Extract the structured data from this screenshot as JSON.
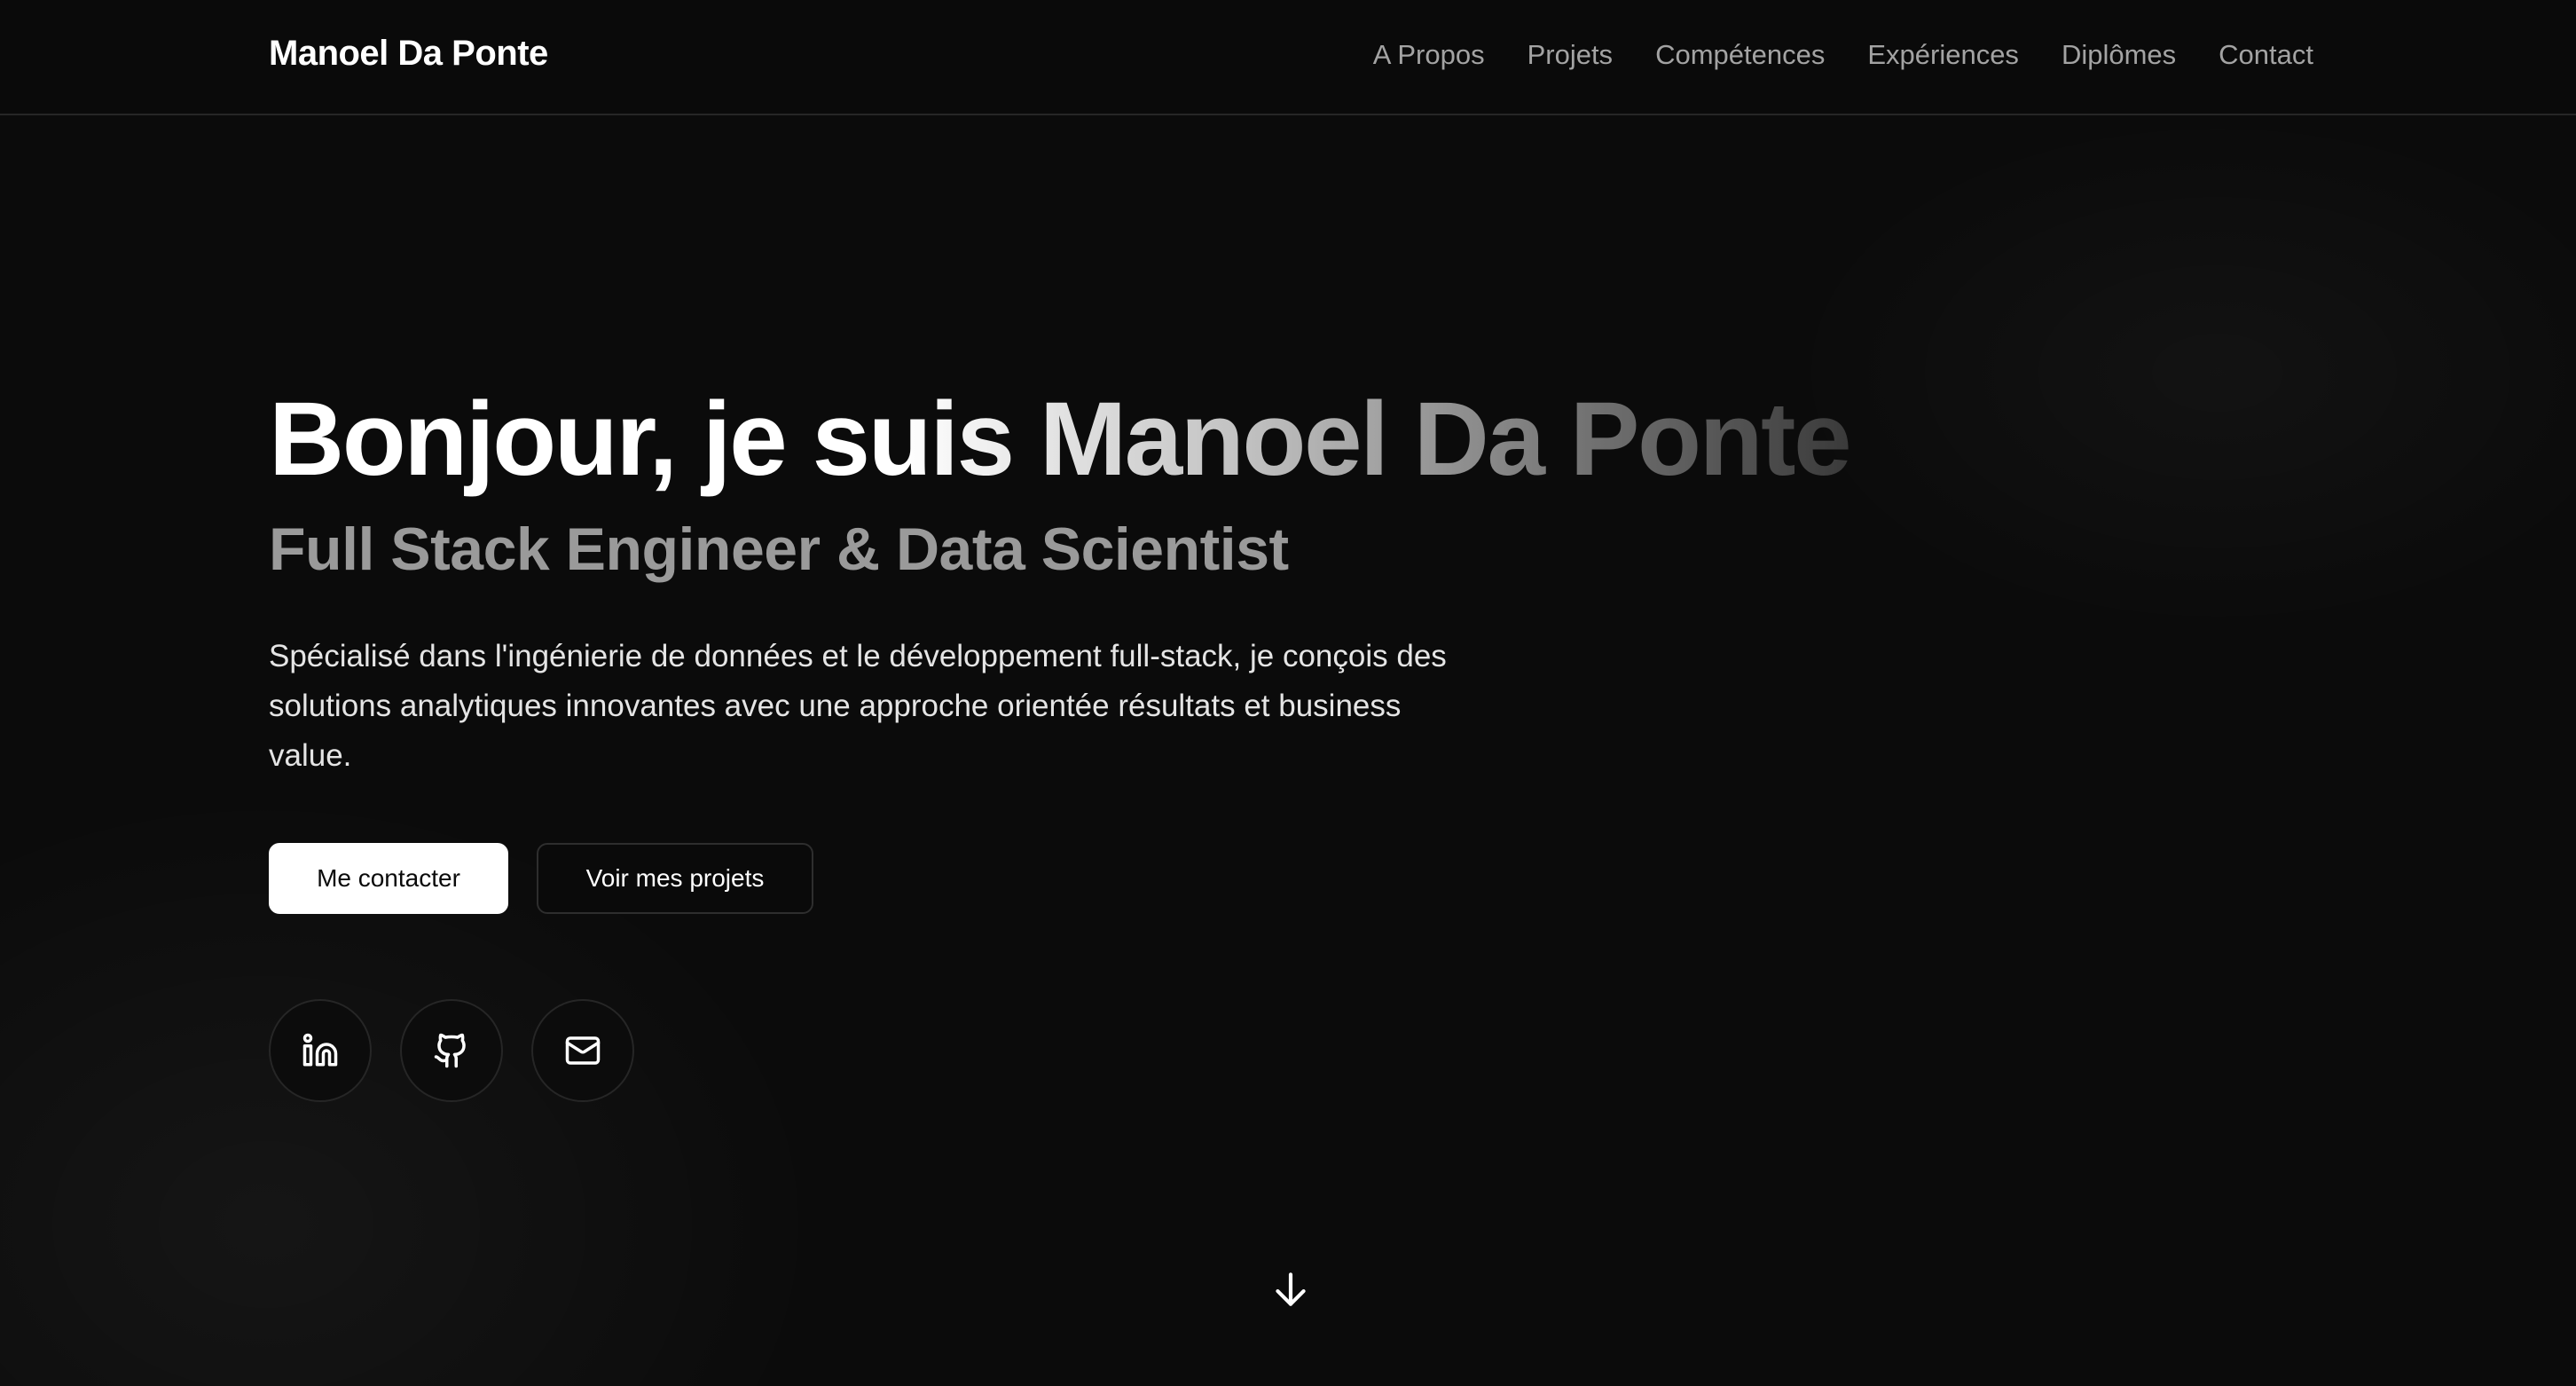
{
  "header": {
    "brand": "Manoel Da Ponte",
    "nav": [
      {
        "label": "A Propos"
      },
      {
        "label": "Projets"
      },
      {
        "label": "Compétences"
      },
      {
        "label": "Expériences"
      },
      {
        "label": "Diplômes"
      },
      {
        "label": "Contact"
      }
    ]
  },
  "hero": {
    "title": "Bonjour, je suis Manoel Da Ponte",
    "subtitle": "Full Stack Engineer & Data Scientist",
    "description": "Spécialisé dans l'ingénierie de données et le développement full-stack, je conçois des solutions analytiques innovantes avec une approche orientée résultats et business value.",
    "primary_button": "Me contacter",
    "secondary_button": "Voir mes projets",
    "socials": [
      {
        "icon": "linkedin-icon"
      },
      {
        "icon": "github-icon"
      },
      {
        "icon": "mail-icon"
      }
    ],
    "scroll_icon": "arrow-down-icon"
  },
  "colors": {
    "background": "#0a0a0a",
    "text": "#ffffff",
    "muted": "#a3a3a3",
    "subtitle": "#9a9a9a",
    "border": "#262626"
  }
}
